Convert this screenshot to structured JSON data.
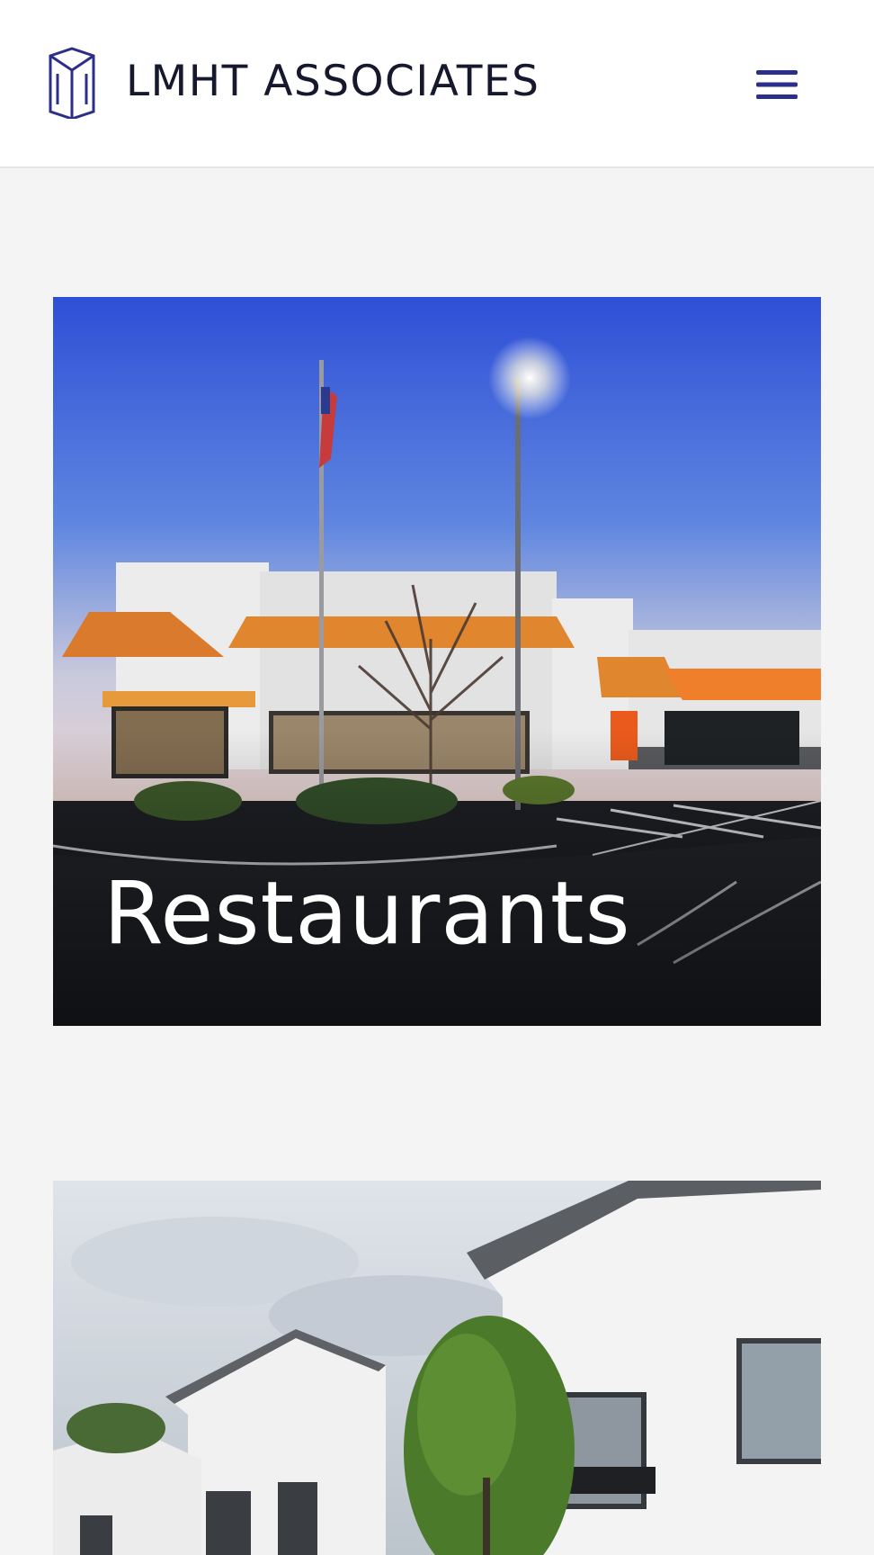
{
  "header": {
    "brand_name": "LMHT ASSOCIATES",
    "logo_icon": "lmht-logo-icon",
    "menu_icon": "hamburger-menu-icon"
  },
  "cards": [
    {
      "title": "Restaurants",
      "image": "homeward-kitchen-restaurant-exterior-photo"
    },
    {
      "title": "",
      "image": "white-residential-buildings-photo"
    }
  ],
  "colors": {
    "brand_dark": "#16182e",
    "accent": "#2b2f8a",
    "page_bg": "#f4f4f5"
  }
}
